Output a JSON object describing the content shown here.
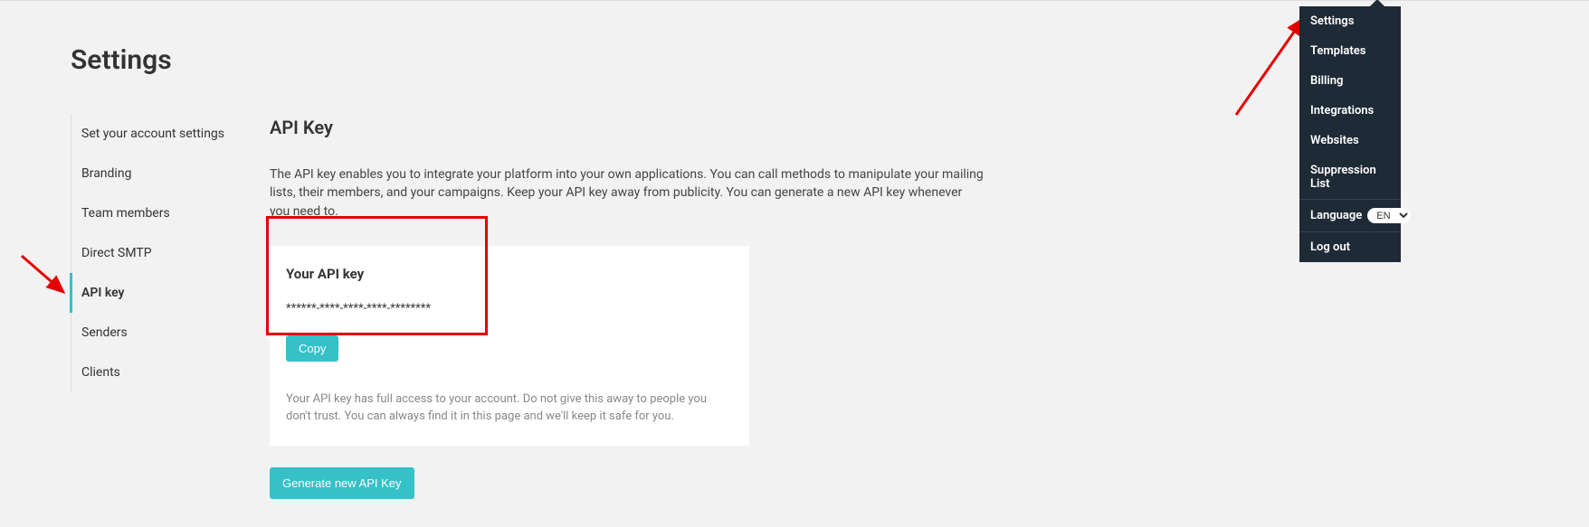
{
  "page": {
    "title": "Settings"
  },
  "sidebar": {
    "items": [
      {
        "label": "Set your account settings"
      },
      {
        "label": "Branding"
      },
      {
        "label": "Team members"
      },
      {
        "label": "Direct SMTP"
      },
      {
        "label": "API key"
      },
      {
        "label": "Senders"
      },
      {
        "label": "Clients"
      }
    ],
    "activeIndex": 4
  },
  "main": {
    "section_title": "API Key",
    "description": "The API key enables you to integrate your platform into your own applications. You can call methods to manipulate your mailing lists, their members, and your campaigns. Keep your API key away from publicity. You can generate a new API key whenever you need to.",
    "api_card": {
      "label": "Your API key",
      "value": "******-****-****-****-********",
      "copy_label": "Copy",
      "note": "Your API key has full access to your account. Do not give this away to people you don't trust. You can always find it in this page and we'll keep it safe for you."
    },
    "generate_label": "Generate new API Key"
  },
  "dropdown": {
    "items": [
      {
        "label": "Settings"
      },
      {
        "label": "Templates"
      },
      {
        "label": "Billing"
      },
      {
        "label": "Integrations"
      },
      {
        "label": "Websites"
      },
      {
        "label": "Suppression List"
      }
    ],
    "language_label": "Language",
    "language_value": "EN",
    "logout_label": "Log out"
  },
  "annotations": {
    "red_box": true,
    "arrows": [
      {
        "target": "sidebar-api-key"
      },
      {
        "target": "dropdown-settings"
      }
    ]
  }
}
